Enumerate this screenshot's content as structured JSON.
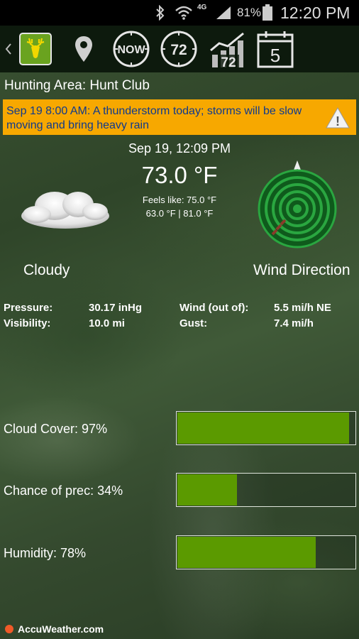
{
  "status_bar": {
    "battery": "81%",
    "time": "12:20 PM",
    "network": "4G"
  },
  "toolbar": {
    "back_icon": "chevron-left-icon",
    "now_label": "NOW",
    "hours_label": "72",
    "chart_label": "72",
    "calendar_day": "5"
  },
  "area": {
    "title": "Hunting Area: Hunt Club"
  },
  "alert": {
    "text": "Sep 19 8:00 AM: A thunderstorm today; storms will be slow moving and bring heavy rain",
    "icon": "warning-icon"
  },
  "current": {
    "datetime": "Sep 19, 12:09 PM",
    "temperature": "73.0 °F",
    "feels_like": "Feels like: 75.0 °F",
    "range": "63.0 °F | 81.0 °F",
    "condition": "Cloudy",
    "condition_icon": "cloud-icon"
  },
  "wind": {
    "title": "Wind Direction",
    "direction": "NE"
  },
  "details": {
    "pressure_label": "Pressure:",
    "pressure_value": "30.17 inHg",
    "visibility_label": "Visibility:",
    "visibility_value": "10.0 mi",
    "wind_label": "Wind (out of):",
    "wind_value": "5.5 mi/h NE",
    "gust_label": "Gust:",
    "gust_value": "7.4 mi/h"
  },
  "bars": [
    {
      "label": "Cloud Cover: 97%",
      "percent": 97
    },
    {
      "label": "Chance of prec: 34%",
      "percent": 34
    },
    {
      "label": "Humidity: 78%",
      "percent": 78
    }
  ],
  "footer": {
    "brand": "AccuWeather.com"
  },
  "colors": {
    "alert_bg": "#f7a800",
    "alert_text": "#0f3a8e",
    "bar_fill": "#5b9a00",
    "radar": "#1e8a32"
  }
}
